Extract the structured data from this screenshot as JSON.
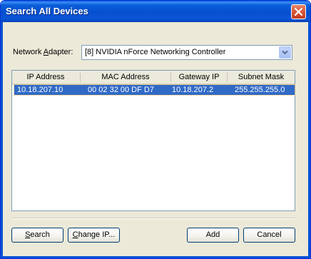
{
  "window": {
    "title": "Search All Devices"
  },
  "adapter": {
    "label_pre": "Network ",
    "label_accel": "A",
    "label_post": "dapter:",
    "selected": "[8] NVIDIA nForce Networking Controller"
  },
  "devices": {
    "columns": [
      "IP Address",
      "MAC Address",
      "Gateway IP",
      "Subnet Mask"
    ],
    "rows": [
      {
        "ip": "10.18.207.10",
        "mac": "00 02 32 00 DF D7",
        "gateway": "10.18.207.2",
        "mask": "255.255.255.0",
        "selected": true
      }
    ]
  },
  "buttons": {
    "search_accel": "S",
    "search_rest": "earch",
    "change_ip_pre": "C",
    "change_ip_rest": "hange IP...",
    "add": "Add",
    "cancel": "Cancel"
  },
  "colors": {
    "title_bar": "#0a5ed8",
    "selection": "#316ac5",
    "close_button": "#d75a3a"
  },
  "icons": {
    "close": "close-icon",
    "dropdown": "chevron-down-icon"
  }
}
